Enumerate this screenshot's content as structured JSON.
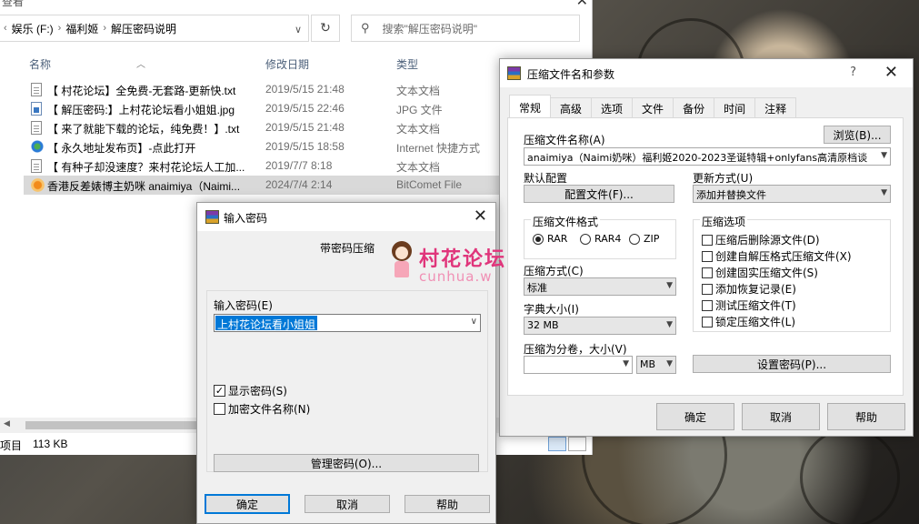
{
  "explorer": {
    "title_fragment": "查看",
    "breadcrumb": [
      "娱乐 (F:)",
      "福利姬",
      "解压密码说明"
    ],
    "search_placeholder": "搜索\"解压密码说明\"",
    "columns": {
      "name": "名称",
      "date": "修改日期",
      "type": "类型"
    },
    "files": [
      {
        "name": "【 村花论坛】全免费-无套路-更新快.txt",
        "date": "2019/5/15 21:48",
        "type": "文本文档",
        "icon": "txt"
      },
      {
        "name": "【 解压密码:】上村花论坛看小姐姐.jpg",
        "date": "2019/5/15 22:46",
        "type": "JPG 文件",
        "icon": "jpg"
      },
      {
        "name": "【 来了就能下载的论坛，纯免费！】.txt",
        "date": "2019/5/15 21:48",
        "type": "文本文档",
        "icon": "txt"
      },
      {
        "name": "【 永久地址发布页】-点此打开",
        "date": "2019/5/15 18:58",
        "type": "Internet 快捷方式",
        "icon": "url"
      },
      {
        "name": "【 有种子却没速度？来村花论坛人工加...",
        "date": "2019/7/7 8:18",
        "type": "文本文档",
        "icon": "txt"
      },
      {
        "name": "香港反差婊博主奶咪 anaimiya（Naimi...",
        "date": "2024/7/4 2:14",
        "type": "BitComet File",
        "icon": "torrent"
      }
    ],
    "status_items": "项目",
    "status_size": "113 KB"
  },
  "password_dialog": {
    "title": "输入密码",
    "subtitle": "带密码压缩",
    "watermark_text": "村花论坛",
    "watermark_url": "cunhua.w",
    "field_label": "输入密码(E)",
    "password_value": "上村花论坛看小姐姐",
    "show_password": "显示密码(S)",
    "encrypt_names": "加密文件名称(N)",
    "manage_button": "管理密码(O)...",
    "ok": "确定",
    "cancel": "取消",
    "help": "帮助"
  },
  "archive_dialog": {
    "title": "压缩文件名和参数",
    "help_mark": "?",
    "tabs": [
      "常规",
      "高级",
      "选项",
      "文件",
      "备份",
      "时间",
      "注释"
    ],
    "archive_name_label": "压缩文件名称(A)",
    "browse": "浏览(B)...",
    "archive_name_value": "anaimiya（Naimi奶咪）福利姬2020-2023圣诞特辑+onlyfans高清原档谈",
    "default_profile_label": "默认配置",
    "profiles_button": "配置文件(F)...",
    "update_mode_label": "更新方式(U)",
    "update_mode_value": "添加并替换文件",
    "format_label": "压缩文件格式",
    "formats": [
      "RAR",
      "RAR4",
      "ZIP"
    ],
    "method_label": "压缩方式(C)",
    "method_value": "标准",
    "dict_label": "字典大小(I)",
    "dict_value": "32 MB",
    "split_label": "压缩为分卷，大小(V)",
    "split_unit": "MB",
    "options_label": "压缩选项",
    "options": [
      "压缩后删除源文件(D)",
      "创建自解压格式压缩文件(X)",
      "创建固实压缩文件(S)",
      "添加恢复记录(E)",
      "测试压缩文件(T)",
      "锁定压缩文件(L)"
    ],
    "set_password": "设置密码(P)...",
    "ok": "确定",
    "cancel": "取消",
    "help": "帮助"
  },
  "colors": {
    "accent": "#0078d7",
    "watermark": "#e0357b"
  }
}
